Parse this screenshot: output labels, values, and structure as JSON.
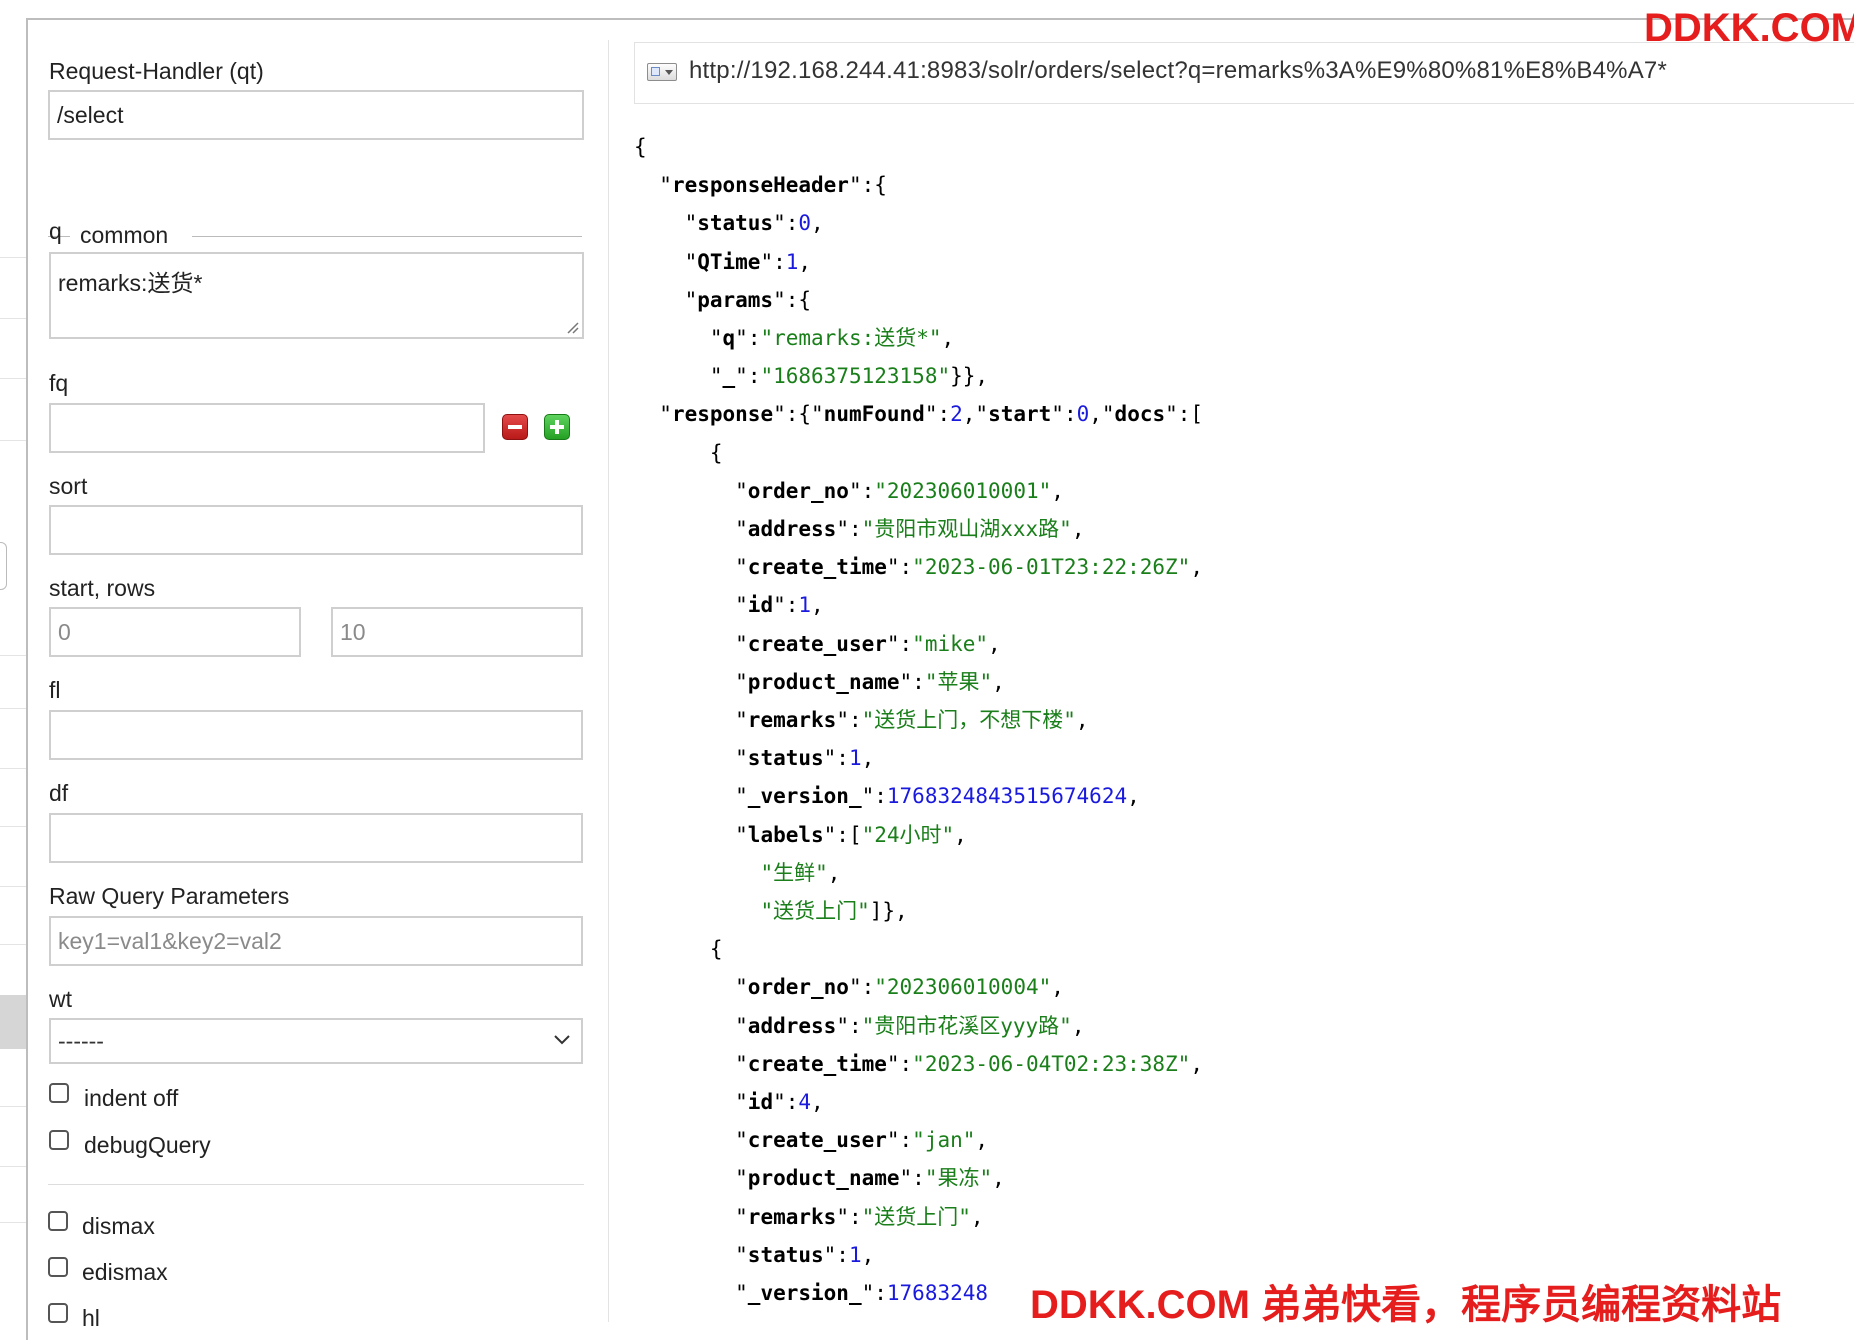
{
  "form": {
    "request_handler": {
      "label": "Request-Handler (qt)",
      "value": "/select"
    },
    "common_legend": "common",
    "q": {
      "label": "q",
      "value": "remarks:送货*"
    },
    "fq": {
      "label": "fq",
      "value": ""
    },
    "sort": {
      "label": "sort",
      "value": ""
    },
    "start_rows": {
      "label": "start, rows",
      "start_value": "0",
      "rows_value": "10"
    },
    "fl": {
      "label": "fl",
      "value": ""
    },
    "df": {
      "label": "df",
      "value": ""
    },
    "raw_params": {
      "label": "Raw Query Parameters",
      "placeholder": "key1=val1&key2=val2"
    },
    "wt": {
      "label": "wt",
      "selected": "------"
    },
    "checkboxes": [
      {
        "label": "indent off",
        "checked": false
      },
      {
        "label": "debugQuery",
        "checked": false
      },
      {
        "label": "dismax",
        "checked": false
      },
      {
        "label": "edismax",
        "checked": false
      },
      {
        "label": "hl",
        "checked": false
      }
    ]
  },
  "result": {
    "url": "http://192.168.244.41:8983/solr/orders/select?q=remarks%3A%E9%80%81%E8%B4%A7*",
    "url_icon": "window-dropdown-icon",
    "json_lines": [
      [
        [
          "p",
          "{"
        ]
      ],
      [
        [
          "p",
          "  \""
        ],
        [
          "k",
          "responseHeader"
        ],
        [
          "p",
          "\":{"
        ]
      ],
      [
        [
          "p",
          "    \""
        ],
        [
          "k",
          "status"
        ],
        [
          "p",
          "\":"
        ],
        [
          "n",
          "0"
        ],
        [
          "p",
          ","
        ]
      ],
      [
        [
          "p",
          "    \""
        ],
        [
          "k",
          "QTime"
        ],
        [
          "p",
          "\":"
        ],
        [
          "n",
          "1"
        ],
        [
          "p",
          ","
        ]
      ],
      [
        [
          "p",
          "    \""
        ],
        [
          "k",
          "params"
        ],
        [
          "p",
          "\":{"
        ]
      ],
      [
        [
          "p",
          "      \""
        ],
        [
          "k",
          "q"
        ],
        [
          "p",
          "\":"
        ],
        [
          "s",
          "\"remarks:送货*\""
        ],
        [
          "p",
          ","
        ]
      ],
      [
        [
          "p",
          "      \""
        ],
        [
          "k",
          "_"
        ],
        [
          "p",
          "\":"
        ],
        [
          "s",
          "\"1686375123158\""
        ],
        [
          "p",
          "}},"
        ]
      ],
      [
        [
          "p",
          "  \""
        ],
        [
          "k",
          "response"
        ],
        [
          "p",
          "\":{\""
        ],
        [
          "k",
          "numFound"
        ],
        [
          "p",
          "\":"
        ],
        [
          "n",
          "2"
        ],
        [
          "p",
          ",\""
        ],
        [
          "k",
          "start"
        ],
        [
          "p",
          "\":"
        ],
        [
          "n",
          "0"
        ],
        [
          "p",
          ",\""
        ],
        [
          "k",
          "docs"
        ],
        [
          "p",
          "\":["
        ]
      ],
      [
        [
          "p",
          "      {"
        ]
      ],
      [
        [
          "p",
          "        \""
        ],
        [
          "k",
          "order_no"
        ],
        [
          "p",
          "\":"
        ],
        [
          "s",
          "\"202306010001\""
        ],
        [
          "p",
          ","
        ]
      ],
      [
        [
          "p",
          "        \""
        ],
        [
          "k",
          "address"
        ],
        [
          "p",
          "\":"
        ],
        [
          "s",
          "\"贵阳市观山湖xxx路\""
        ],
        [
          "p",
          ","
        ]
      ],
      [
        [
          "p",
          "        \""
        ],
        [
          "k",
          "create_time"
        ],
        [
          "p",
          "\":"
        ],
        [
          "s",
          "\"2023-06-01T23:22:26Z\""
        ],
        [
          "p",
          ","
        ]
      ],
      [
        [
          "p",
          "        \""
        ],
        [
          "k",
          "id"
        ],
        [
          "p",
          "\":"
        ],
        [
          "n",
          "1"
        ],
        [
          "p",
          ","
        ]
      ],
      [
        [
          "p",
          "        \""
        ],
        [
          "k",
          "create_user"
        ],
        [
          "p",
          "\":"
        ],
        [
          "s",
          "\"mike\""
        ],
        [
          "p",
          ","
        ]
      ],
      [
        [
          "p",
          "        \""
        ],
        [
          "k",
          "product_name"
        ],
        [
          "p",
          "\":"
        ],
        [
          "s",
          "\"苹果\""
        ],
        [
          "p",
          ","
        ]
      ],
      [
        [
          "p",
          "        \""
        ],
        [
          "k",
          "remarks"
        ],
        [
          "p",
          "\":"
        ],
        [
          "s",
          "\"送货上门，不想下楼\""
        ],
        [
          "p",
          ","
        ]
      ],
      [
        [
          "p",
          "        \""
        ],
        [
          "k",
          "status"
        ],
        [
          "p",
          "\":"
        ],
        [
          "n",
          "1"
        ],
        [
          "p",
          ","
        ]
      ],
      [
        [
          "p",
          "        \""
        ],
        [
          "k",
          "_version_"
        ],
        [
          "p",
          "\":"
        ],
        [
          "n",
          "1768324843515674624"
        ],
        [
          "p",
          ","
        ]
      ],
      [
        [
          "p",
          "        \""
        ],
        [
          "k",
          "labels"
        ],
        [
          "p",
          "\":["
        ],
        [
          "s",
          "\"24小时\""
        ],
        [
          "p",
          ","
        ]
      ],
      [
        [
          "p",
          "          "
        ],
        [
          "s",
          "\"生鲜\""
        ],
        [
          "p",
          ","
        ]
      ],
      [
        [
          "p",
          "          "
        ],
        [
          "s",
          "\"送货上门\""
        ],
        [
          "p",
          "]},"
        ]
      ],
      [
        [
          "p",
          "      {"
        ]
      ],
      [
        [
          "p",
          "        \""
        ],
        [
          "k",
          "order_no"
        ],
        [
          "p",
          "\":"
        ],
        [
          "s",
          "\"202306010004\""
        ],
        [
          "p",
          ","
        ]
      ],
      [
        [
          "p",
          "        \""
        ],
        [
          "k",
          "address"
        ],
        [
          "p",
          "\":"
        ],
        [
          "s",
          "\"贵阳市花溪区yyy路\""
        ],
        [
          "p",
          ","
        ]
      ],
      [
        [
          "p",
          "        \""
        ],
        [
          "k",
          "create_time"
        ],
        [
          "p",
          "\":"
        ],
        [
          "s",
          "\"2023-06-04T02:23:38Z\""
        ],
        [
          "p",
          ","
        ]
      ],
      [
        [
          "p",
          "        \""
        ],
        [
          "k",
          "id"
        ],
        [
          "p",
          "\":"
        ],
        [
          "n",
          "4"
        ],
        [
          "p",
          ","
        ]
      ],
      [
        [
          "p",
          "        \""
        ],
        [
          "k",
          "create_user"
        ],
        [
          "p",
          "\":"
        ],
        [
          "s",
          "\"jan\""
        ],
        [
          "p",
          ","
        ]
      ],
      [
        [
          "p",
          "        \""
        ],
        [
          "k",
          "product_name"
        ],
        [
          "p",
          "\":"
        ],
        [
          "s",
          "\"果冻\""
        ],
        [
          "p",
          ","
        ]
      ],
      [
        [
          "p",
          "        \""
        ],
        [
          "k",
          "remarks"
        ],
        [
          "p",
          "\":"
        ],
        [
          "s",
          "\"送货上门\""
        ],
        [
          "p",
          ","
        ]
      ],
      [
        [
          "p",
          "        \""
        ],
        [
          "k",
          "status"
        ],
        [
          "p",
          "\":"
        ],
        [
          "n",
          "1"
        ],
        [
          "p",
          ","
        ]
      ],
      [
        [
          "p",
          "        \""
        ],
        [
          "k",
          "_version_"
        ],
        [
          "p",
          "\":"
        ],
        [
          "n",
          "17683248"
        ]
      ]
    ]
  },
  "watermark": {
    "top": "DDKK.COM",
    "bottom": "DDKK.COM 弟弟快看，程序员编程资料站"
  }
}
